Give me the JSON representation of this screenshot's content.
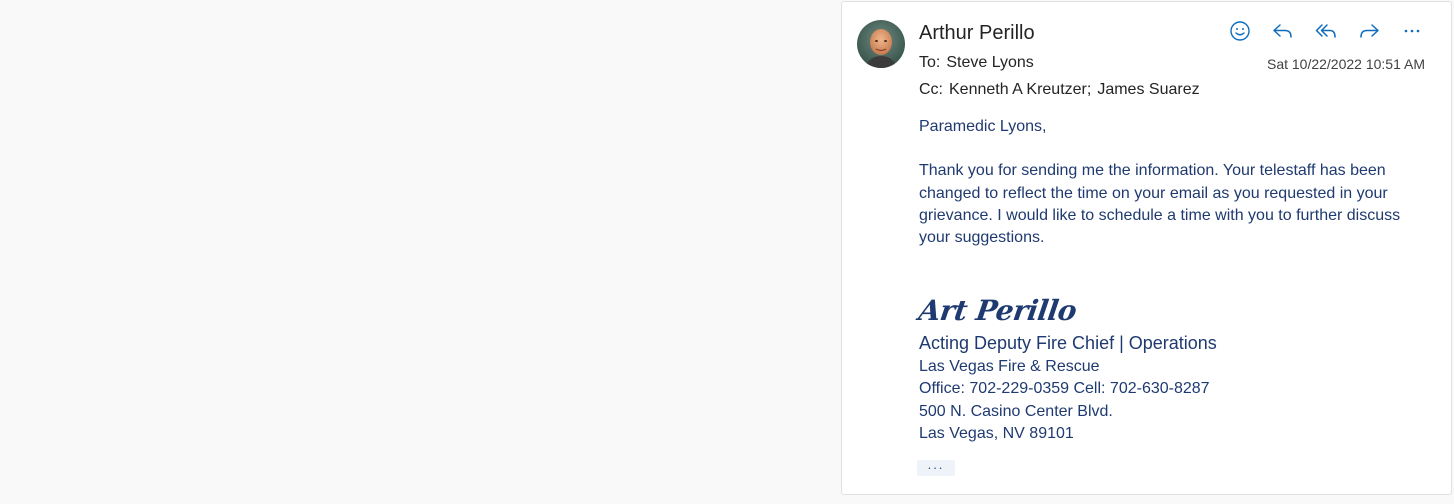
{
  "message": {
    "sender": "Arthur Perillo",
    "to_label": "To:",
    "to": "Steve Lyons",
    "cc_label": "Cc:",
    "cc": [
      "Kenneth A Kreutzer",
      "James Suarez"
    ],
    "cc_separator": ";",
    "date": "Sat 10/22/2022 10:51 AM"
  },
  "actions": [
    {
      "name": "react",
      "icon": "smiley-icon"
    },
    {
      "name": "reply",
      "icon": "reply-icon"
    },
    {
      "name": "reply-all",
      "icon": "reply-all-icon"
    },
    {
      "name": "forward",
      "icon": "forward-icon"
    },
    {
      "name": "more",
      "icon": "more-icon"
    }
  ],
  "body": {
    "greeting": "Paramedic Lyons,",
    "paragraph": "Thank you for sending me the information.  Your telestaff has been changed to reflect the time on your email as you requested in your grievance.   I would like to schedule a time with you to further discuss your suggestions."
  },
  "signature": {
    "handwritten": "Art Perillo",
    "title": "Acting Deputy Fire Chief | Operations",
    "lines": [
      "Las Vegas Fire & Rescue",
      "Office: 702-229-0359 Cell: 702-630-8287",
      "500 N. Casino Center Blvd.",
      "Las Vegas, NV  89101"
    ]
  },
  "more_label": "...",
  "colors": {
    "accent": "#0f6cbd",
    "body_text": "#1f3a70",
    "page_bg": "#f9f9f9"
  }
}
